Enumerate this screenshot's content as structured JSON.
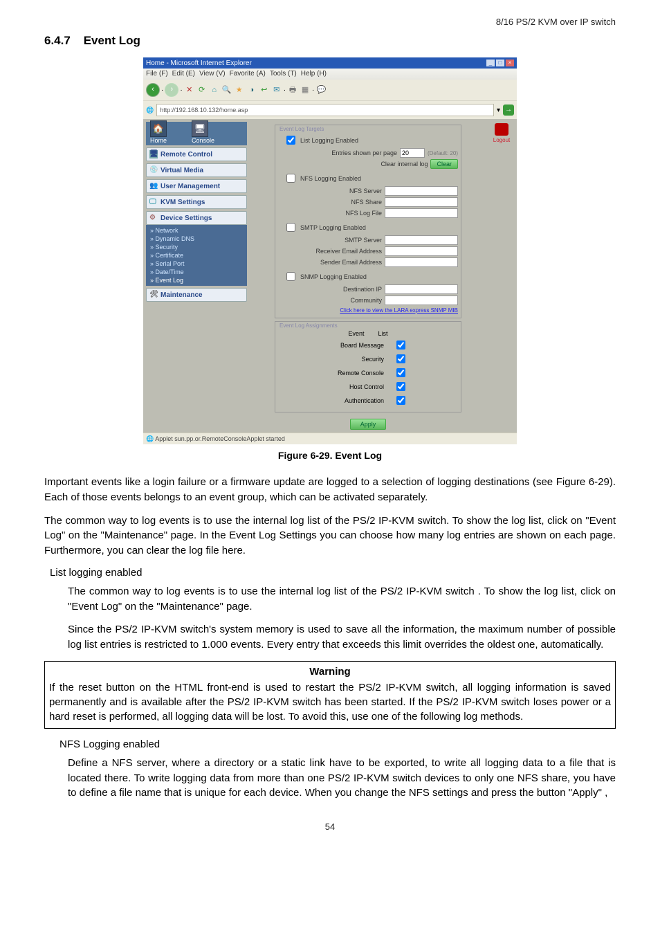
{
  "header_right": "8/16 PS/2 KVM over IP switch",
  "section_no": "6.4.7",
  "section_title": "Event Log",
  "caption": "Figure 6-29. Event Log",
  "page_number": "54",
  "para1": "Important events like a login failure or a firmware update are logged to a selection of logging destinations (see Figure 6-29). Each of those events belongs to an event group, which can be activated separately.",
  "para2": "The common way to log events is to use the internal log list of the PS/2 IP-KVM switch. To show the log list, click on \"Event Log\" on the \"Maintenance\" page. In the Event Log Settings you can choose how many log entries are shown on each page. Furthermore, you can clear the log file here.",
  "sub1": "List logging enabled",
  "sub1_p1": "The common way to log events is to use the internal log list of the PS/2 IP-KVM switch . To show the log list, click on \"Event Log\" on the \"Maintenance\" page.",
  "sub1_p2": "Since the PS/2 IP-KVM switch's system memory is used to save all the information, the maximum number of possible log list entries is restricted to 1.000 events. Every entry that exceeds this limit overrides the oldest one, automatically.",
  "warn_title": "Warning",
  "warn_body": "If the reset button on the HTML front-end is used to restart the PS/2 IP-KVM switch, all logging information is saved permanently and is available after the PS/2 IP-KVM switch has been started. If the PS/2 IP-KVM switch loses power or a hard reset is performed, all logging data will be lost. To avoid this, use one of the following log methods.",
  "sub2": "NFS Logging enabled",
  "sub2_p1": "Define a NFS server, where a directory or a static link have to be exported, to write all logging data to a file that is located there. To write logging data from more than one PS/2 IP-KVM switch devices to only one NFS share, you have to define a file name that is unique for each device. When you change the NFS settings and press the button \"Apply\" ,",
  "ss": {
    "titlebar": "Home - Microsoft Internet Explorer",
    "menu": [
      "File (F)",
      "Edit (E)",
      "View (V)",
      "Favorite (A)",
      "Tools (T)",
      "Help (H)"
    ],
    "address": "http://192.168.10.132/home.asp",
    "home_label": "Home",
    "console_label": "Console",
    "logout": "Logout",
    "nav": {
      "remote": "Remote Control",
      "virtual": "Virtual Media",
      "user": "User Management",
      "kvm": "KVM Settings",
      "device": "Device Settings",
      "maint": "Maintenance"
    },
    "sub": {
      "network": "Network",
      "dns": "Dynamic DNS",
      "security": "Security",
      "cert": "Certificate",
      "serial": "Serial Port",
      "datetime": "Date/Time",
      "eventlog": "Event Log"
    },
    "targets": {
      "legend": "Event Log Targets",
      "list_enabled": "List Logging Enabled",
      "entries_label": "Entries shown per page",
      "entries_value": "20",
      "entries_default": "(Default: 20)",
      "clear_label": "Clear internal log",
      "clear_btn": "Clear",
      "nfs_enabled": "NFS Logging Enabled",
      "nfs_server": "NFS Server",
      "nfs_share": "NFS Share",
      "nfs_file": "NFS Log File",
      "smtp_enabled": "SMTP Logging Enabled",
      "smtp_server": "SMTP Server",
      "recv": "Receiver Email Address",
      "sender": "Sender Email Address",
      "snmp_enabled": "SNMP Logging Enabled",
      "dest_ip": "Destination IP",
      "community": "Community",
      "mib_link": "Click here to view the LARA express SNMP MIB"
    },
    "assign": {
      "legend": "Event Log Assignments",
      "col1": "Event",
      "col2": "List",
      "rows": [
        "Board Message",
        "Security",
        "Remote Console",
        "Host Control",
        "Authentication"
      ]
    },
    "apply": "Apply",
    "status": "Applet sun.pp.or.RemoteConsoleApplet started"
  }
}
